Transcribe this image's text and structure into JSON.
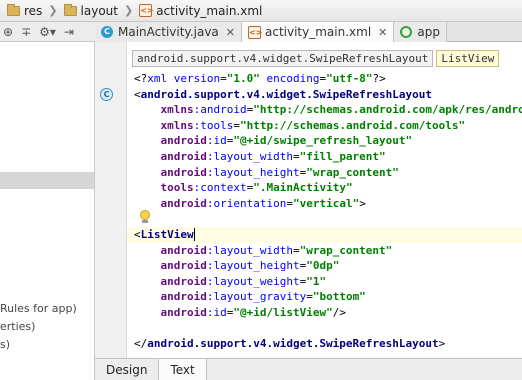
{
  "navbar": {
    "crumbs": [
      "res",
      "layout",
      "activity_main.xml"
    ]
  },
  "tabs": [
    {
      "label": "MainActivity.java",
      "icon": "class-icon",
      "active": false
    },
    {
      "label": "activity_main.xml",
      "icon": "xml-file-icon",
      "active": true
    },
    {
      "label": "app",
      "icon": "gradle-module-icon",
      "active": false
    }
  ],
  "xml_breadcrumbs": [
    "android.support.v4.widget.SwipeRefreshLayout",
    "ListView"
  ],
  "project_panel": {
    "lines": [
      "Rules for app)",
      "erties)",
      "s)"
    ]
  },
  "code_lines": [
    [
      [
        "plain",
        "<?"
      ],
      [
        "attr",
        "xml version"
      ],
      [
        "plain",
        "="
      ],
      [
        "val",
        "\"1.0\""
      ],
      [
        "plain",
        " "
      ],
      [
        "attr",
        "encoding"
      ],
      [
        "plain",
        "="
      ],
      [
        "val",
        "\"utf-8\""
      ],
      [
        "plain",
        "?>"
      ]
    ],
    [
      [
        "plain",
        "<"
      ],
      [
        "tag",
        "android.support.v4.widget.SwipeRefreshLayout"
      ]
    ],
    [
      [
        "plain",
        "    "
      ],
      [
        "ns",
        "xmlns"
      ],
      [
        "attr",
        ":android"
      ],
      [
        "plain",
        "="
      ],
      [
        "val",
        "\"http://schemas.android.com/apk/res/android\""
      ]
    ],
    [
      [
        "plain",
        "    "
      ],
      [
        "ns",
        "xmlns"
      ],
      [
        "attr",
        ":tools"
      ],
      [
        "plain",
        "="
      ],
      [
        "val",
        "\"http://schemas.android.com/tools\""
      ]
    ],
    [
      [
        "plain",
        "    "
      ],
      [
        "ns",
        "android"
      ],
      [
        "attr",
        ":id"
      ],
      [
        "plain",
        "="
      ],
      [
        "val",
        "\"@+id/swipe_refresh_layout\""
      ]
    ],
    [
      [
        "plain",
        "    "
      ],
      [
        "ns",
        "android"
      ],
      [
        "attr",
        ":layout_width"
      ],
      [
        "plain",
        "="
      ],
      [
        "val",
        "\"fill_parent\""
      ]
    ],
    [
      [
        "plain",
        "    "
      ],
      [
        "ns",
        "android"
      ],
      [
        "attr",
        ":layout_height"
      ],
      [
        "plain",
        "="
      ],
      [
        "val",
        "\"wrap_content\""
      ]
    ],
    [
      [
        "plain",
        "    "
      ],
      [
        "ns",
        "tools"
      ],
      [
        "attr",
        ":context"
      ],
      [
        "plain",
        "="
      ],
      [
        "val",
        "\".MainActivity\""
      ]
    ],
    [
      [
        "plain",
        "    "
      ],
      [
        "ns",
        "android"
      ],
      [
        "attr",
        ":orientation"
      ],
      [
        "plain",
        "="
      ],
      [
        "val",
        "\"vertical\""
      ],
      [
        "plain",
        ">"
      ]
    ],
    [],
    [
      [
        "plain",
        "<"
      ],
      [
        "tag",
        "ListView"
      ]
    ],
    [
      [
        "plain",
        "    "
      ],
      [
        "ns",
        "android"
      ],
      [
        "attr",
        ":layout_width"
      ],
      [
        "plain",
        "="
      ],
      [
        "val",
        "\"wrap_content\""
      ]
    ],
    [
      [
        "plain",
        "    "
      ],
      [
        "ns",
        "android"
      ],
      [
        "attr",
        ":layout_height"
      ],
      [
        "plain",
        "="
      ],
      [
        "val",
        "\"0dp\""
      ]
    ],
    [
      [
        "plain",
        "    "
      ],
      [
        "ns",
        "android"
      ],
      [
        "attr",
        ":layout_weight"
      ],
      [
        "plain",
        "="
      ],
      [
        "val",
        "\"1\""
      ]
    ],
    [
      [
        "plain",
        "    "
      ],
      [
        "ns",
        "android"
      ],
      [
        "attr",
        ":layout_gravity"
      ],
      [
        "plain",
        "="
      ],
      [
        "val",
        "\"bottom\""
      ]
    ],
    [
      [
        "plain",
        "    "
      ],
      [
        "ns",
        "android"
      ],
      [
        "attr",
        ":id"
      ],
      [
        "plain",
        "="
      ],
      [
        "val",
        "\"@+id/listView\""
      ],
      [
        "plain",
        "/>"
      ]
    ],
    [],
    [
      [
        "plain",
        "</"
      ],
      [
        "tag",
        "android.support.v4.widget.SwipeRefreshLayout"
      ],
      [
        "plain",
        ">"
      ]
    ]
  ],
  "highlighted_line": 10,
  "bottom_tabs": [
    {
      "label": "Design",
      "active": false
    },
    {
      "label": "Text",
      "active": true
    }
  ]
}
